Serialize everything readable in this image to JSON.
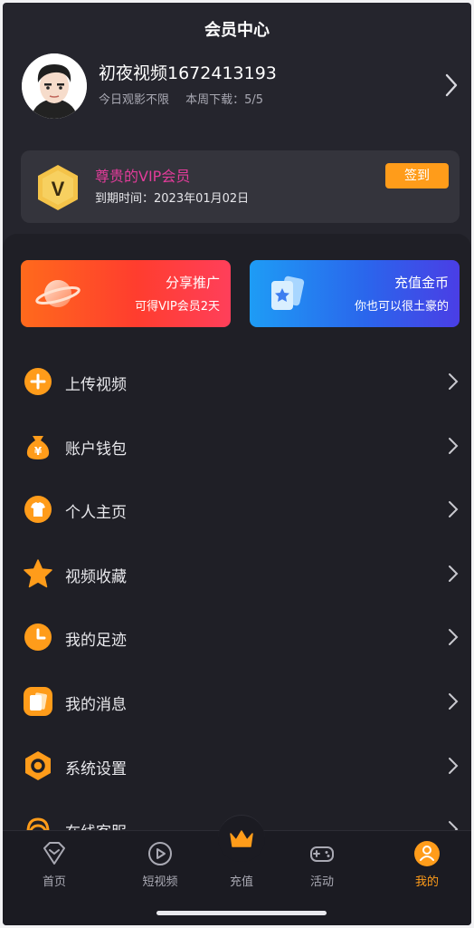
{
  "header": {
    "title": "会员中心"
  },
  "profile": {
    "username": "初夜视频1672413193",
    "watch_limit": "今日观影不限",
    "download_quota": "本周下载：5/5"
  },
  "vip": {
    "badge_letter": "V",
    "title": "尊贵的VIP会员",
    "expire": "到期时间：2023年01月02日",
    "checkin_label": "签到"
  },
  "promos": [
    {
      "title": "分享推广",
      "subtitle": "可得VIP会员2天"
    },
    {
      "title": "充值金币",
      "subtitle": "你也可以很土豪的"
    }
  ],
  "menu": [
    {
      "label": "上传视频",
      "icon": "upload-plus-icon"
    },
    {
      "label": "账户钱包",
      "icon": "money-bag-icon"
    },
    {
      "label": "个人主页",
      "icon": "shirt-icon"
    },
    {
      "label": "视频收藏",
      "icon": "star-icon"
    },
    {
      "label": "我的足迹",
      "icon": "clock-icon"
    },
    {
      "label": "我的消息",
      "icon": "message-cards-icon"
    },
    {
      "label": "系统设置",
      "icon": "hexagon-settings-icon"
    },
    {
      "label": "在线客服",
      "icon": "customer-service-icon"
    }
  ],
  "tabbar": {
    "items": [
      {
        "label": "首页",
        "icon": "home-diamond-icon"
      },
      {
        "label": "短视频",
        "icon": "play-circle-icon"
      },
      {
        "label": "充值",
        "icon": "crown-icon"
      },
      {
        "label": "活动",
        "icon": "gamepad-icon"
      },
      {
        "label": "我的",
        "icon": "user-icon"
      }
    ],
    "active_label": "我的"
  },
  "colors": {
    "background": "#25252d",
    "accent_orange": "#ff9c1a",
    "vip_pink": "#e23c9a",
    "text_secondary": "#a9a9b3"
  }
}
